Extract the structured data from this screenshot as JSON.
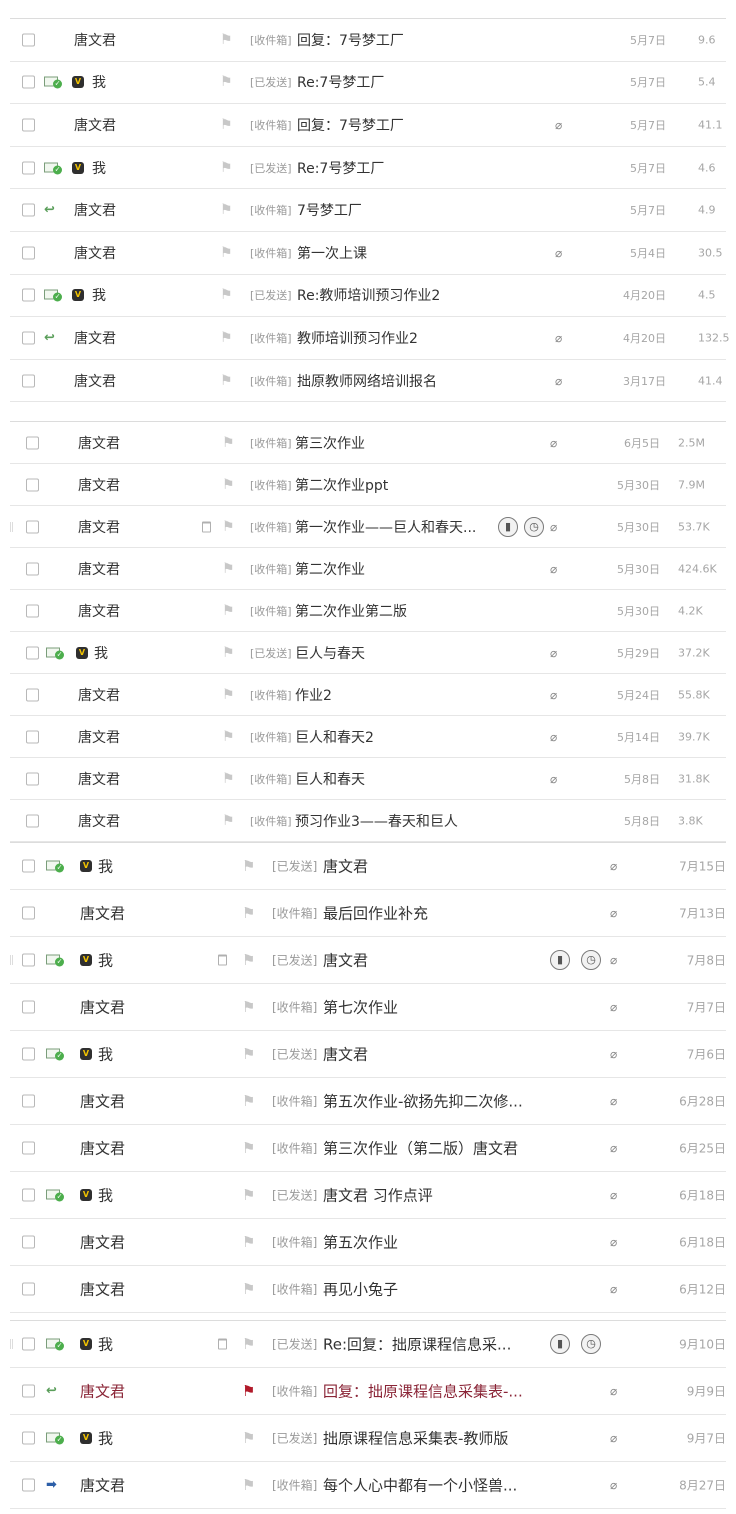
{
  "folder_labels": {
    "inbox": "[收件箱]",
    "sent": "[已发送]"
  },
  "status_icons": {
    "sent": "sent-envelope-icon",
    "reply": "replied-arrow-icon",
    "forward": "forwarded-arrow-icon"
  },
  "colors": {
    "flagged": "#8a2436",
    "flag_red": "#b11a2a",
    "meta_gray": "#a6a6a6"
  },
  "sections": [
    {
      "id": "batch-1",
      "rows": [
        {
          "sender": "唐文君",
          "folder": "inbox",
          "subject": "回复：7号梦工厂",
          "date": "5月7日",
          "size": "9.6",
          "attach": false
        },
        {
          "sender": "我",
          "folder": "sent",
          "subject": "Re:7号梦工厂",
          "date": "5月7日",
          "size": "5.4",
          "status": "sent",
          "me": true
        },
        {
          "sender": "唐文君",
          "folder": "inbox",
          "subject": "回复：7号梦工厂",
          "date": "5月7日",
          "size": "41.1",
          "attach": true
        },
        {
          "sender": "我",
          "folder": "sent",
          "subject": "Re:7号梦工厂",
          "date": "5月7日",
          "size": "4.6",
          "status": "sent",
          "me": true
        },
        {
          "sender": "唐文君",
          "folder": "inbox",
          "subject": "7号梦工厂",
          "date": "5月7日",
          "size": "4.9",
          "status": "reply"
        },
        {
          "sender": "唐文君",
          "folder": "inbox",
          "subject": "第一次上课",
          "date": "5月4日",
          "size": "30.5",
          "attach": true
        },
        {
          "sender": "我",
          "folder": "sent",
          "subject": "Re:教师培训预习作业2",
          "date": "4月20日",
          "size": "4.5",
          "status": "sent",
          "me": true
        },
        {
          "sender": "唐文君",
          "folder": "inbox",
          "subject": "教师培训预习作业2",
          "date": "4月20日",
          "size": "132.5",
          "status": "reply",
          "attach": true
        },
        {
          "sender": "唐文君",
          "folder": "inbox",
          "subject": "拙原教师网络培训报名",
          "date": "3月17日",
          "size": "41.4",
          "attach": true
        }
      ]
    },
    {
      "id": "batch-2",
      "rows": [
        {
          "sender": "唐文君",
          "folder": "inbox",
          "subject": "第三次作业",
          "date": "6月5日",
          "size": "2.5M",
          "attach": true
        },
        {
          "sender": "唐文君",
          "folder": "inbox",
          "subject": "第二次作业ppt",
          "date": "5月30日",
          "size": "7.9M"
        },
        {
          "sender": "唐文君",
          "folder": "inbox",
          "subject": "第一次作业——巨人和春天...",
          "date": "5月30日",
          "size": "53.7K",
          "attach": true,
          "hover": true
        },
        {
          "sender": "唐文君",
          "folder": "inbox",
          "subject": "第二次作业",
          "date": "5月30日",
          "size": "424.6K",
          "attach": true
        },
        {
          "sender": "唐文君",
          "folder": "inbox",
          "subject": "第二次作业第二版",
          "date": "5月30日",
          "size": "4.2K"
        },
        {
          "sender": "我",
          "folder": "sent",
          "subject": "巨人与春天",
          "date": "5月29日",
          "size": "37.2K",
          "status": "sent",
          "me": true,
          "attach": true
        },
        {
          "sender": "唐文君",
          "folder": "inbox",
          "subject": "作业2",
          "date": "5月24日",
          "size": "55.8K",
          "attach": true
        },
        {
          "sender": "唐文君",
          "folder": "inbox",
          "subject": "巨人和春天2",
          "date": "5月14日",
          "size": "39.7K",
          "attach": true
        },
        {
          "sender": "唐文君",
          "folder": "inbox",
          "subject": "巨人和春天",
          "date": "5月8日",
          "size": "31.8K",
          "attach": true
        },
        {
          "sender": "唐文君",
          "folder": "inbox",
          "subject": "预习作业3——春天和巨人",
          "date": "5月8日",
          "size": "3.8K"
        }
      ]
    },
    {
      "id": "batch-3",
      "rows": [
        {
          "sender": "我",
          "folder": "sent",
          "subject": "唐文君",
          "date": "7月15日",
          "status": "sent",
          "me": true,
          "attach": true
        },
        {
          "sender": "唐文君",
          "folder": "inbox",
          "subject": "最后回作业补充",
          "date": "7月13日",
          "attach": true
        },
        {
          "sender": "我",
          "folder": "sent",
          "subject": "唐文君",
          "date": "7月8日",
          "status": "sent",
          "me": true,
          "attach": true,
          "hover": true
        },
        {
          "sender": "唐文君",
          "folder": "inbox",
          "subject": "第七次作业",
          "date": "7月7日",
          "attach": true
        },
        {
          "sender": "我",
          "folder": "sent",
          "subject": "唐文君",
          "date": "7月6日",
          "status": "sent",
          "me": true,
          "attach": true
        },
        {
          "sender": "唐文君",
          "folder": "inbox",
          "subject": "第五次作业-欲扬先抑二次修...",
          "date": "6月28日",
          "attach": true
        },
        {
          "sender": "唐文君",
          "folder": "inbox",
          "subject": "第三次作业（第二版）唐文君",
          "date": "6月25日",
          "attach": true
        },
        {
          "sender": "我",
          "folder": "sent",
          "subject": "唐文君 习作点评",
          "date": "6月18日",
          "status": "sent",
          "me": true,
          "attach": true
        },
        {
          "sender": "唐文君",
          "folder": "inbox",
          "subject": "第五次作业",
          "date": "6月18日",
          "attach": true
        },
        {
          "sender": "唐文君",
          "folder": "inbox",
          "subject": "再见小兔子",
          "date": "6月12日",
          "attach": true
        }
      ]
    },
    {
      "id": "batch-4",
      "rows": [
        {
          "sender": "我",
          "folder": "sent",
          "subject": "Re:回复：拙原课程信息采...",
          "date": "9月10日",
          "status": "sent",
          "me": true,
          "hover": true
        },
        {
          "sender": "唐文君",
          "folder": "inbox",
          "subject": "回复：拙原课程信息采集表-...",
          "date": "9月9日",
          "status": "reply",
          "flagged": true,
          "attach": true
        },
        {
          "sender": "我",
          "folder": "sent",
          "subject": "拙原课程信息采集表-教师版",
          "date": "9月7日",
          "status": "sent",
          "me": true,
          "attach": true
        },
        {
          "sender": "唐文君",
          "folder": "inbox",
          "subject": "每个人心中都有一个小怪兽...",
          "date": "8月27日",
          "status": "forward",
          "attach": true
        }
      ]
    }
  ]
}
